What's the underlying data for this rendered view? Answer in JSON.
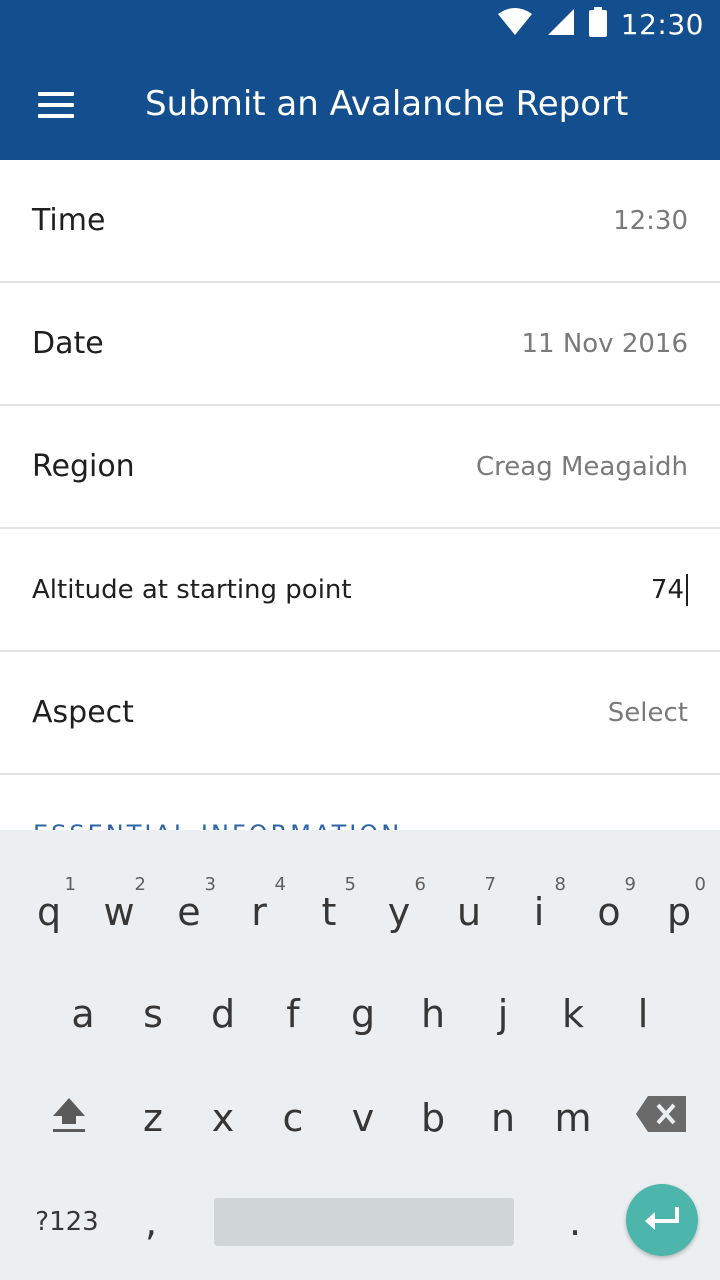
{
  "status": {
    "time": "12:30"
  },
  "appbar": {
    "title": "Submit an Avalanche Report"
  },
  "form": {
    "rows": [
      {
        "label": "Time",
        "value": "12:30"
      },
      {
        "label": "Date",
        "value": "11 Nov 2016"
      },
      {
        "label": "Region",
        "value": "Creag Meagaidh"
      },
      {
        "label": "Altitude at starting point",
        "value": "74"
      },
      {
        "label": "Aspect",
        "value": "Select"
      }
    ],
    "section_title": "ESSENTIAL INFORMATION"
  },
  "keyboard": {
    "row1": [
      {
        "key": "q",
        "hint": "1"
      },
      {
        "key": "w",
        "hint": "2"
      },
      {
        "key": "e",
        "hint": "3"
      },
      {
        "key": "r",
        "hint": "4"
      },
      {
        "key": "t",
        "hint": "5"
      },
      {
        "key": "y",
        "hint": "6"
      },
      {
        "key": "u",
        "hint": "7"
      },
      {
        "key": "i",
        "hint": "8"
      },
      {
        "key": "o",
        "hint": "9"
      },
      {
        "key": "p",
        "hint": "0"
      }
    ],
    "row2": [
      "a",
      "s",
      "d",
      "f",
      "g",
      "h",
      "j",
      "k",
      "l"
    ],
    "row3": [
      "z",
      "x",
      "c",
      "v",
      "b",
      "n",
      "m"
    ],
    "row4": {
      "symbols": "?123",
      "comma": ",",
      "period": "."
    }
  },
  "colors": {
    "primary": "#134e8f",
    "accent": "#4db6ac",
    "keyboard_bg": "#eceff1"
  },
  "icons": [
    "wifi-icon",
    "signal-icon",
    "battery-icon",
    "menu-icon",
    "shift-icon",
    "backspace-icon",
    "enter-icon"
  ]
}
